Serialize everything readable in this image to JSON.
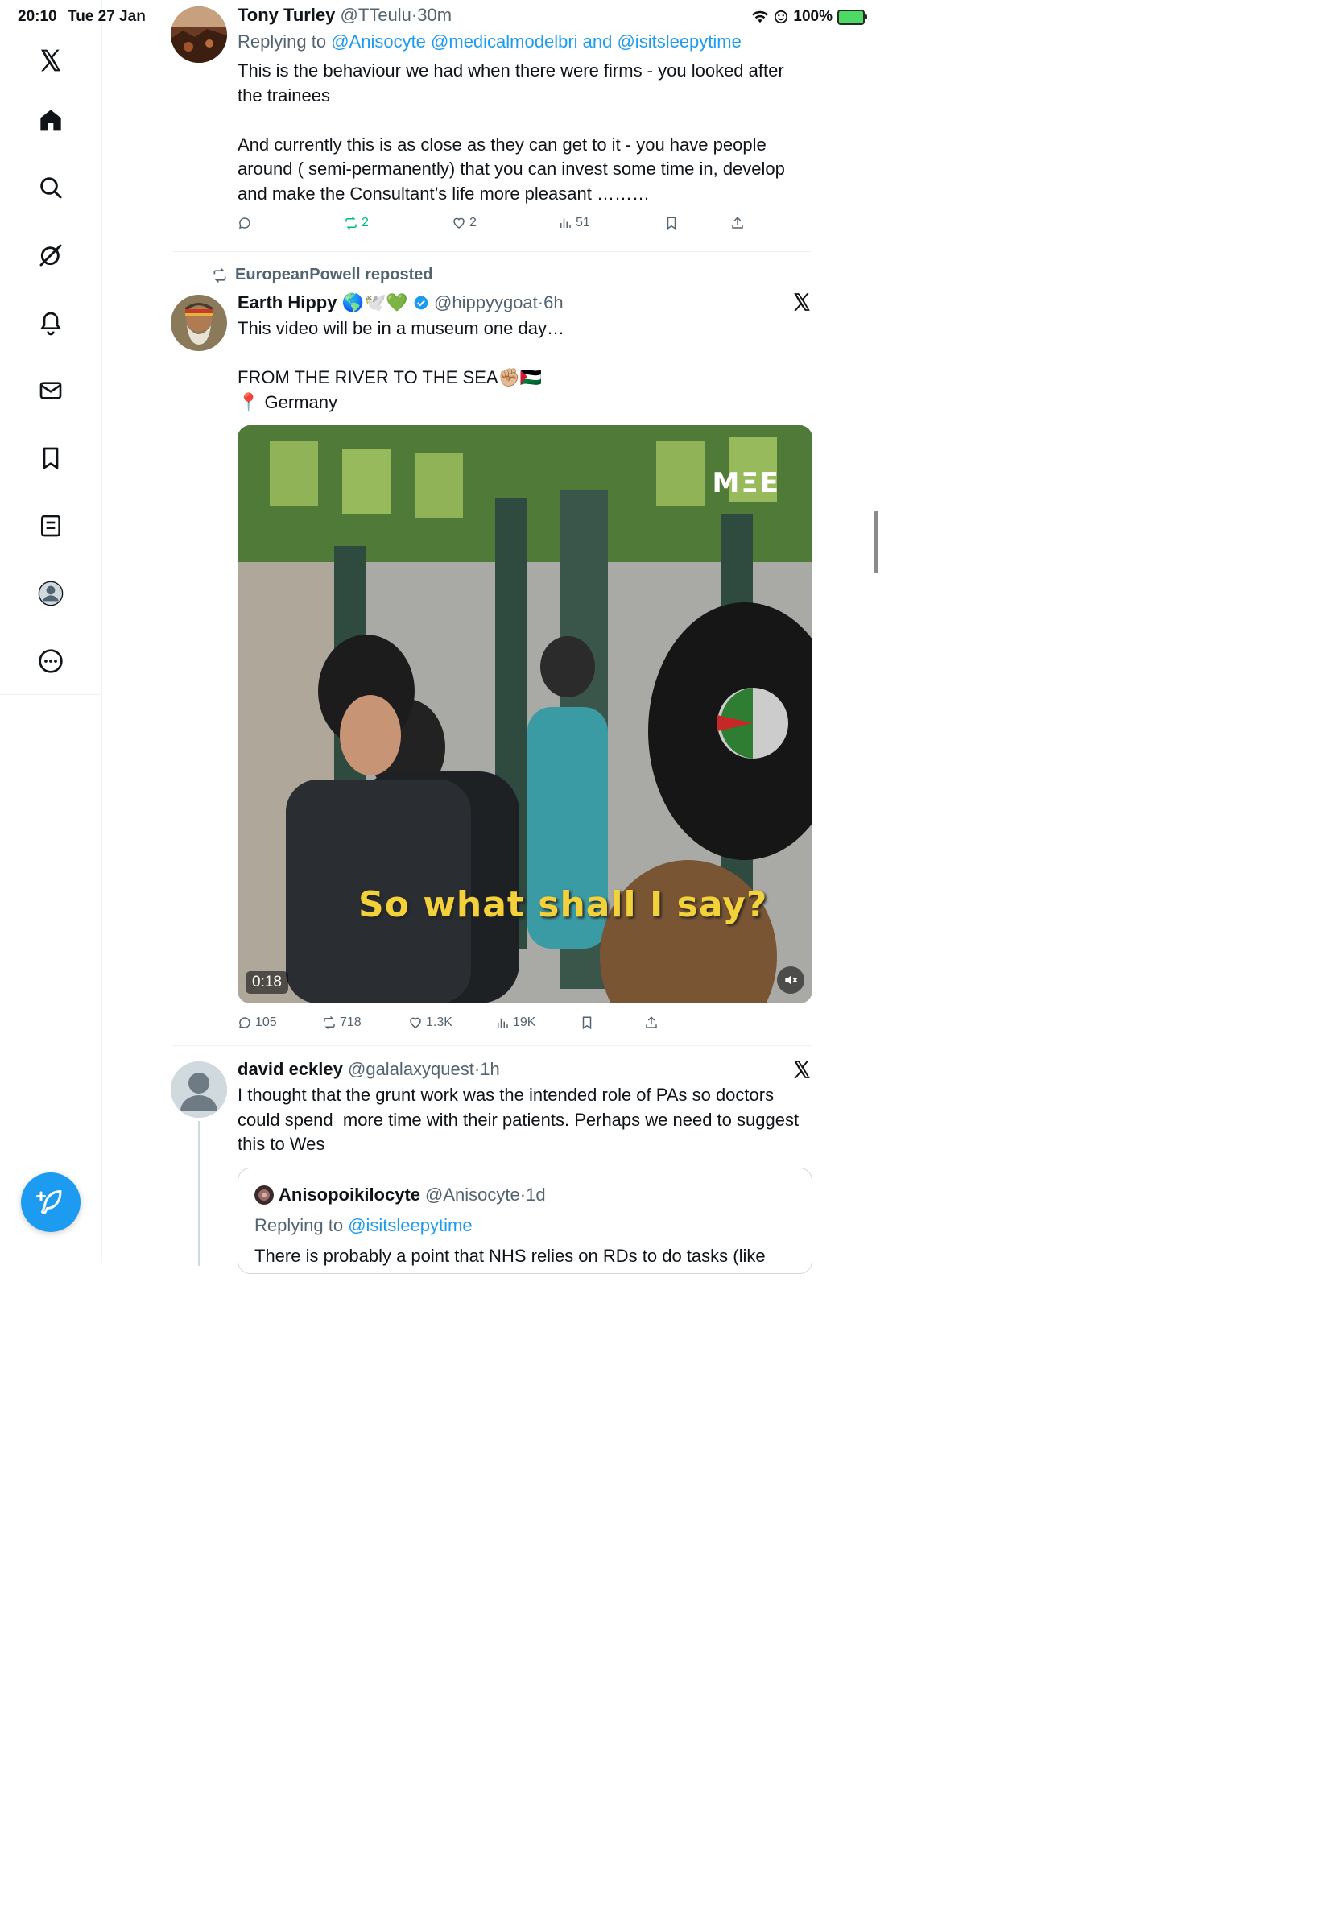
{
  "status_bar": {
    "time": "20:10",
    "date": "Tue 27 Jan",
    "battery": "100%"
  },
  "sidebar": {
    "items": [
      {
        "name": "home"
      },
      {
        "name": "explore"
      },
      {
        "name": "grok"
      },
      {
        "name": "notifications"
      },
      {
        "name": "messages"
      },
      {
        "name": "bookmarks"
      },
      {
        "name": "lists"
      },
      {
        "name": "profile"
      },
      {
        "name": "more"
      }
    ]
  },
  "tweets": [
    {
      "name": "Tony Turley",
      "handle": "@TTeulu",
      "dot": "·",
      "ago": "30m",
      "reply_prefix": "Replying to",
      "reply_mentions": "@Anisocyte @medicalmodelbri and @isitsleepytime",
      "text": "This is the behaviour we had when there were firms - you looked after the trainees\n\nAnd currently this is as close as they can get to it - you have people around ( semi-permanently) that you can invest some time in, develop and make the Consultant’s life more pleasant ………",
      "stats": {
        "replies": "",
        "reposts": "2",
        "likes": "2",
        "views": "51"
      }
    },
    {
      "repost_by": "EuropeanPowell reposted",
      "name": "Earth Hippy",
      "emojis": "🌎🕊️💚",
      "handle": "@hippyygoat",
      "dot": "·",
      "ago": "6h",
      "text": "This video will be in a museum one day…\n\nFROM THE RIVER TO THE SEA✊🏼🇵🇸\n📍 Germany",
      "video": {
        "duration": "0:18",
        "caption": "So what shall I say?",
        "watermark": "MΞE"
      },
      "stats": {
        "replies": "105",
        "reposts": "718",
        "likes": "1.3K",
        "views": "19K"
      }
    },
    {
      "name": "david eckley",
      "handle": "@galalaxyquest",
      "dot": "·",
      "ago": "1h",
      "text": "I thought that the grunt work was the intended role of PAs so doctors could spend  more time with their patients. Perhaps we need to suggest this to Wes",
      "quote": {
        "name": "Anisopoikilocyte",
        "handle": "@Anisocyte",
        "dot": "·",
        "ago": "1d",
        "reply_prefix": "Replying to",
        "reply_mentions": "@isitsleepytime",
        "text": "There is probably a point that NHS relies on RDs to do tasks (like"
      }
    }
  ],
  "colors": {
    "accent": "#1d9bf0",
    "repost_green": "#00ba7c",
    "muted": "#536471"
  }
}
